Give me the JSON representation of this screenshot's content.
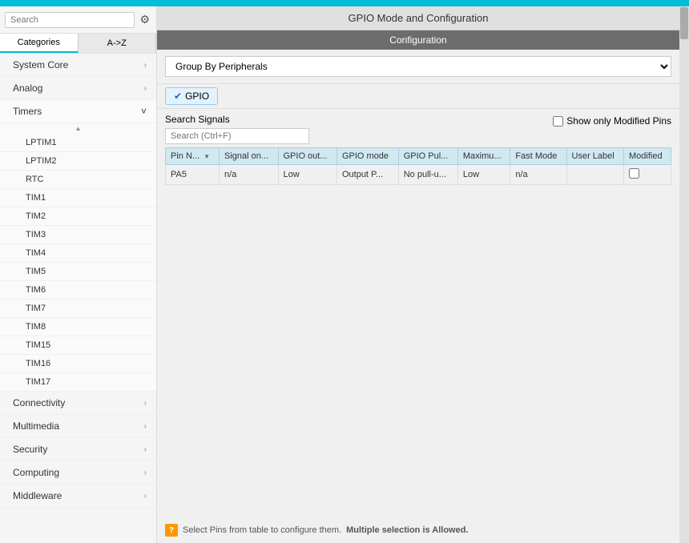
{
  "topbar": {},
  "window_title": "GPIO Mode and Configuration",
  "sidebar": {
    "search_placeholder": "Search",
    "tab_categories": "Categories",
    "tab_az": "A->Z",
    "items": [
      {
        "id": "system-core",
        "label": "System Core",
        "has_arrow": true,
        "expanded": false
      },
      {
        "id": "analog",
        "label": "Analog",
        "has_arrow": true,
        "expanded": false
      },
      {
        "id": "timers",
        "label": "Timers",
        "has_arrow": true,
        "expanded": true
      },
      {
        "id": "connectivity",
        "label": "Connectivity",
        "has_arrow": true,
        "expanded": false
      },
      {
        "id": "multimedia",
        "label": "Multimedia",
        "has_arrow": true,
        "expanded": false
      },
      {
        "id": "security",
        "label": "Security",
        "has_arrow": true,
        "expanded": false
      },
      {
        "id": "computing",
        "label": "Computing",
        "has_arrow": true,
        "expanded": false
      },
      {
        "id": "middleware",
        "label": "Middleware",
        "has_arrow": true,
        "expanded": false
      }
    ],
    "timer_sub_items": [
      "LPTIM1",
      "LPTIM2",
      "RTC",
      "TIM1",
      "TIM2",
      "TIM3",
      "TIM4",
      "TIM5",
      "TIM6",
      "TIM7",
      "TIM8",
      "TIM15",
      "TIM16",
      "TIM17"
    ]
  },
  "main": {
    "config_label": "Configuration",
    "group_by_label": "Group By Peripherals",
    "gpio_tab_label": "GPIO",
    "search_signals_label": "Search Signals",
    "search_placeholder": "Search (Ctrl+F)",
    "show_modified_label": "Show only Modified Pins",
    "table": {
      "columns": [
        {
          "id": "pin-name",
          "label": "Pin N..."
        },
        {
          "id": "signal-on",
          "label": "Signal on..."
        },
        {
          "id": "gpio-out",
          "label": "GPIO out..."
        },
        {
          "id": "gpio-mode",
          "label": "GPIO mode"
        },
        {
          "id": "gpio-pull",
          "label": "GPIO Pul..."
        },
        {
          "id": "maximum",
          "label": "Maximu..."
        },
        {
          "id": "fast-mode",
          "label": "Fast Mode"
        },
        {
          "id": "user-label",
          "label": "User Label"
        },
        {
          "id": "modified",
          "label": "Modified"
        }
      ],
      "rows": [
        {
          "pin_name": "PA5",
          "signal_on": "n/a",
          "gpio_out": "Low",
          "gpio_mode": "Output P...",
          "gpio_pull": "No pull-u...",
          "maximum": "Low",
          "fast_mode": "n/a",
          "user_label": "",
          "modified": false
        }
      ]
    },
    "hint_text": "Select Pins from table to configure them.",
    "hint_bold": "Multiple selection is Allowed."
  }
}
